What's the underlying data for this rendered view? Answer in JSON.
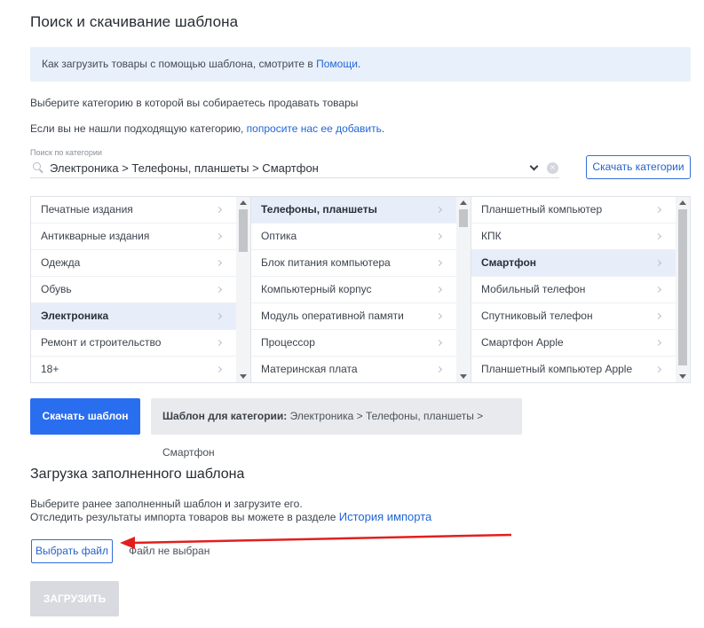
{
  "header": {
    "title": "Поиск и скачивание шаблона"
  },
  "info": {
    "text": "Как загрузить товары с помощью шаблона, смотрите в ",
    "link": "Помощи",
    "suffix": "."
  },
  "intro": {
    "line1": "Выберите категорию в которой вы собираетесь продавать товары",
    "line2": "Если вы не нашли подходящую категорию, ",
    "line2_link": "попросите нас ее добавить",
    "line2_suffix": "."
  },
  "search": {
    "label": "Поиск по категории",
    "value": "Электроника > Телефоны, планшеты > Смартфон",
    "icon": "search-icon",
    "clear_glyph": "×"
  },
  "download_categories_label": "Скачать категории",
  "columns": [
    {
      "items": [
        {
          "label": "Печатные издания",
          "selected": false
        },
        {
          "label": "Антикварные издания",
          "selected": false
        },
        {
          "label": "Одежда",
          "selected": false
        },
        {
          "label": "Обувь",
          "selected": false
        },
        {
          "label": "Электроника",
          "selected": true
        },
        {
          "label": "Ремонт и строительство",
          "selected": false
        },
        {
          "label": "18+",
          "selected": false
        }
      ],
      "scroll_position": 0.15
    },
    {
      "items": [
        {
          "label": "Телефоны, планшеты",
          "selected": true
        },
        {
          "label": "Оптика",
          "selected": false
        },
        {
          "label": "Блок питания компьютера",
          "selected": false
        },
        {
          "label": "Компьютерный корпус",
          "selected": false
        },
        {
          "label": "Модуль оперативной памяти",
          "selected": false
        },
        {
          "label": "Процессор",
          "selected": false
        },
        {
          "label": "Материнская плата",
          "selected": false
        }
      ],
      "scroll_position": 0.1
    },
    {
      "items": [
        {
          "label": "Планшетный компьютер",
          "selected": false
        },
        {
          "label": "КПК",
          "selected": false
        },
        {
          "label": "Смартфон",
          "selected": true
        },
        {
          "label": "Мобильный телефон",
          "selected": false
        },
        {
          "label": "Спутниковый телефон",
          "selected": false
        },
        {
          "label": "Смартфон Apple",
          "selected": false
        },
        {
          "label": "Планшетный компьютер Apple",
          "selected": false
        }
      ],
      "scroll_position": 0.9
    }
  ],
  "download_template_label": "Скачать шаблон",
  "template_info": {
    "prefix": "Шаблон для категории:",
    "value": " Электроника > Телефоны, планшеты > Смартфон"
  },
  "upload": {
    "title": "Загрузка заполненного шаблона",
    "line1": "Выберите ранее заполненный шаблон и загрузите его.",
    "line2": "Отследить результаты импорта товаров вы можете в разделе ",
    "line2_link": "История импорта",
    "choose_file_label": "Выбрать файл",
    "file_status": "Файл не выбран",
    "submit_label": "ЗАГРУЗИТЬ"
  },
  "colors": {
    "accent": "#2a6ef0",
    "annotation_arrow": "#e0201f"
  }
}
